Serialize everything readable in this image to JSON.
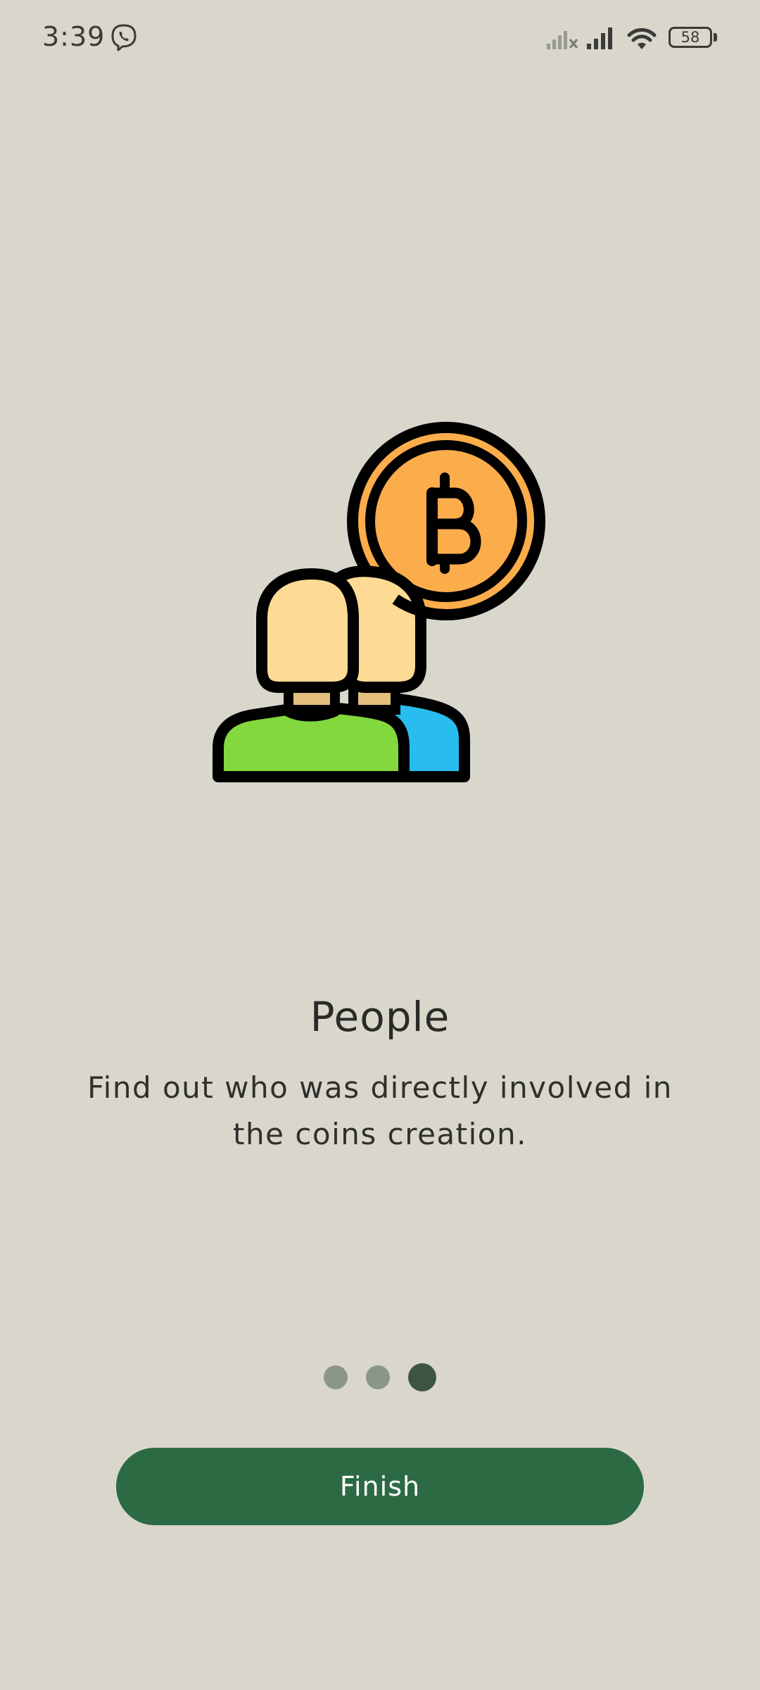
{
  "status_bar": {
    "time": "3:39",
    "battery_level": "58",
    "icons": [
      "viber-icon",
      "signal-no-service-icon",
      "signal-icon",
      "wifi-icon",
      "battery-icon"
    ]
  },
  "onboarding": {
    "illustration_icon": "people-bitcoin-icon",
    "title": "People",
    "description": "Find out who was directly involved in the coins creation.",
    "page_indicator": {
      "total": 3,
      "current": 3
    },
    "finish_label": "Finish"
  },
  "colors": {
    "background": "#d9d7cc",
    "button": "#2c6a43",
    "dot_active": "#3c5444",
    "dot_inactive": "#8a9687",
    "coin": "#fcad4b",
    "skin": "#fedb94",
    "shirt_green": "#82d83c",
    "shirt_blue": "#29bdef"
  }
}
